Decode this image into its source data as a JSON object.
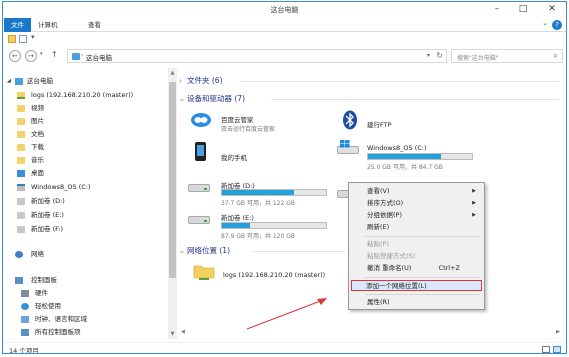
{
  "window": {
    "title": "这台电脑"
  },
  "ribbon": {
    "tabs": [
      {
        "label": "文件"
      },
      {
        "label": "计算机"
      },
      {
        "label": "查看"
      }
    ]
  },
  "address": {
    "path": "这台电脑",
    "search_placeholder": "搜索\"这台电脑\""
  },
  "nav": {
    "items": [
      {
        "label": "这台电脑",
        "icon": "pc-icon"
      },
      {
        "label": "logs (192.168.210.20 (master))",
        "icon": "network-drive-icon"
      },
      {
        "label": "视频",
        "icon": "video-folder-icon"
      },
      {
        "label": "图片",
        "icon": "pictures-folder-icon"
      },
      {
        "label": "文档",
        "icon": "documents-folder-icon"
      },
      {
        "label": "下载",
        "icon": "downloads-folder-icon"
      },
      {
        "label": "音乐",
        "icon": "music-folder-icon"
      },
      {
        "label": "桌面",
        "icon": "desktop-folder-icon"
      },
      {
        "label": "Windows8_OS (C:)",
        "icon": "windows-drive-icon"
      },
      {
        "label": "新加卷 (D:)",
        "icon": "drive-icon"
      },
      {
        "label": "新加卷 (E:)",
        "icon": "drive-icon"
      },
      {
        "label": "新加卷 (F:)",
        "icon": "drive-icon"
      },
      {
        "label": "网络",
        "icon": "network-icon"
      },
      {
        "label": "控制面板",
        "icon": "control-panel-icon"
      },
      {
        "label": "硬件",
        "icon": "hardware-icon"
      },
      {
        "label": "轻松使用",
        "icon": "ease-of-access-icon"
      },
      {
        "label": "时钟、语言和区域",
        "icon": "clock-language-icon"
      },
      {
        "label": "所有控制面板项",
        "icon": "control-panel-items-icon"
      }
    ]
  },
  "main": {
    "folders_group": "文件夹 (6)",
    "devices_group": "设备和驱动器 (7)",
    "network_group": "网络位置 (1)",
    "devices": [
      {
        "title": "百度云管家",
        "sub": "双击运行百度云管家",
        "icon": "baidu-cloud-icon"
      },
      {
        "title": "建行FTP",
        "icon": "bluetooth-icon"
      },
      {
        "title": "我的手机",
        "icon": "phone-icon"
      },
      {
        "title": "Windows8_OS (C:)",
        "sub": "25.0 GB 可用，共 84.7 GB",
        "fill": 0.7
      },
      {
        "title": "新加卷 (D:)",
        "sub": "37.7 GB 可用，共 122 GB",
        "fill": 0.69
      },
      {
        "title": "新加卷 (E:)",
        "sub": "87.9 GB 可用，共 120 GB",
        "fill": 0.27
      }
    ],
    "network_location": {
      "title": "logs (192.168.210.20 (master))",
      "icon": "network-folder-icon"
    }
  },
  "context_menu": {
    "items": [
      {
        "label": "查看(V)",
        "submenu": true
      },
      {
        "label": "排序方式(O)",
        "submenu": true
      },
      {
        "label": "分组依据(P)",
        "submenu": true
      },
      {
        "label": "刷新(E)"
      },
      {
        "label": "粘贴(P)",
        "disabled": true
      },
      {
        "label": "粘贴快捷方式(S)",
        "disabled": true
      },
      {
        "label": "撤消 重命名(U)",
        "shortcut": "Ctrl+Z"
      },
      {
        "label": "添加一个网络位置(L)",
        "highlighted": true
      },
      {
        "label": "属性(R)"
      }
    ]
  },
  "status": {
    "text": "14 个项目"
  },
  "colors": {
    "accent": "#1979ca",
    "bar_fill": "#26a0da",
    "group_heading": "#1e3287",
    "highlight_border": "#d8363a",
    "arrow": "#d8363a"
  }
}
